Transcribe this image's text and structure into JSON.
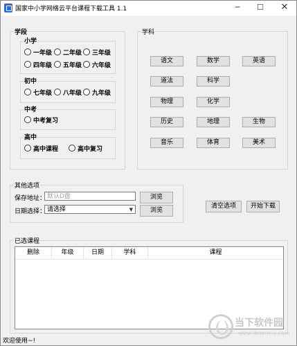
{
  "window": {
    "title": "国家中小学网络云平台课程下载工具 1.1",
    "minimize": "─",
    "maximize": "☐",
    "close": "✕"
  },
  "stage": {
    "label": "学段",
    "primary": {
      "label": "小学",
      "grades": [
        "一年级",
        "二年级",
        "三年级",
        "四年级",
        "五年级",
        "六年级"
      ]
    },
    "junior": {
      "label": "初中",
      "grades": [
        "七年级",
        "八年级",
        "九年级"
      ]
    },
    "zhongkao": {
      "label": "中考",
      "options": [
        "中考复习"
      ]
    },
    "senior": {
      "label": "高中",
      "options": [
        "高中课程",
        "高中复习"
      ]
    }
  },
  "subject": {
    "label": "学科",
    "buttons": [
      "语文",
      "数学",
      "英语",
      "道法",
      "科学",
      "物理",
      "化学",
      "历史",
      "地理",
      "生物",
      "音乐",
      "体育",
      "美术"
    ]
  },
  "other": {
    "label": "其他选项",
    "save_label": "保存地址：",
    "save_placeholder": "默认D盘",
    "browse1": "浏览",
    "date_label": "日期选择：",
    "date_value": "请选择",
    "browse2": "浏览"
  },
  "actions": {
    "clear": "清空选项",
    "start": "开始下载"
  },
  "selected": {
    "label": "已选课程",
    "columns": [
      "删除",
      "年级",
      "日期",
      "学科",
      "课程"
    ]
  },
  "status": "欢迎使用~!",
  "watermark": {
    "text": "当下软件园",
    "sub": "www.downxia.com"
  }
}
